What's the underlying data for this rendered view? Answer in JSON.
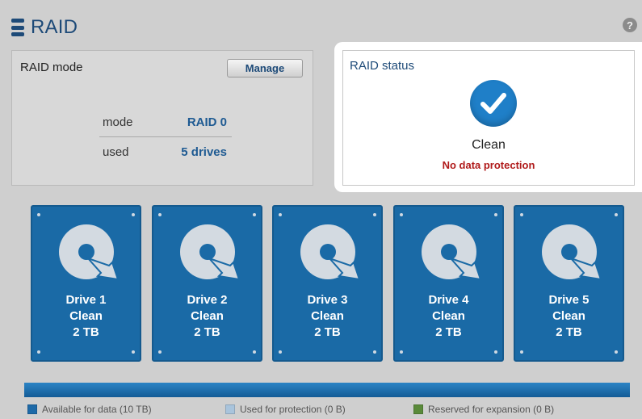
{
  "header": {
    "title": "RAID",
    "db_icon": "database-icon",
    "help_icon": "help-icon",
    "help_glyph": "?"
  },
  "raid_mode": {
    "title": "RAID mode",
    "manage_label": "Manage",
    "rows": [
      {
        "label": "mode",
        "value": "RAID 0"
      },
      {
        "label": "used",
        "value": "5 drives"
      }
    ]
  },
  "raid_status": {
    "title": "RAID status",
    "icon": "check-icon",
    "status": "Clean",
    "warning": "No data protection",
    "warning_color": "#b01a1a"
  },
  "drives": [
    {
      "name": "Drive 1",
      "status": "Clean",
      "size": "2 TB"
    },
    {
      "name": "Drive 2",
      "status": "Clean",
      "size": "2 TB"
    },
    {
      "name": "Drive 3",
      "status": "Clean",
      "size": "2 TB"
    },
    {
      "name": "Drive 4",
      "status": "Clean",
      "size": "2 TB"
    },
    {
      "name": "Drive 5",
      "status": "Clean",
      "size": "2 TB"
    }
  ],
  "capacity": {
    "available_fraction": 1.0,
    "legend": [
      {
        "label": "Available for data (10 TB)",
        "color": "#1e6aa8"
      },
      {
        "label": "Used for protection (0 B)",
        "color": "#a9c4dc"
      },
      {
        "label": "Reserved for expansion (0 B)",
        "color": "#5a8a3a"
      }
    ]
  },
  "colors": {
    "accent": "#1d4a78",
    "drive": "#1a6aa6",
    "status_check": "#1f7fc8"
  }
}
